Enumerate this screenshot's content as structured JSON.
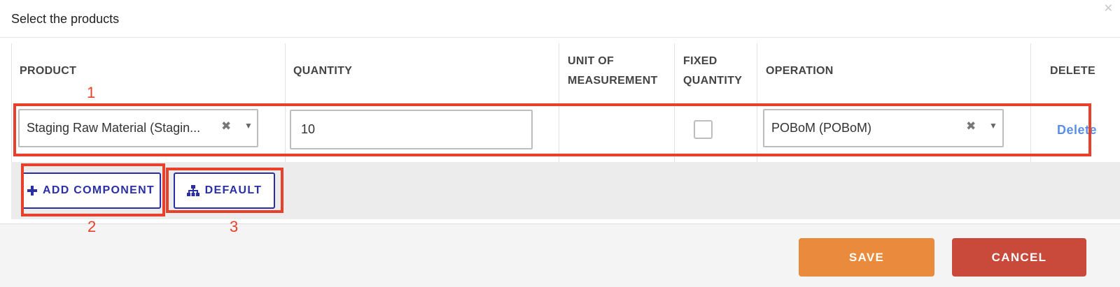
{
  "modal": {
    "title": "Select the products",
    "close_icon": "close-icon"
  },
  "table": {
    "headers": {
      "product": "PRODUCT",
      "quantity": "QUANTITY",
      "uom_line1": "UNIT OF",
      "uom_line2": "MEASUREMENT",
      "fixed_line1": "FIXED",
      "fixed_line2": "QUANTITY",
      "operation": "OPERATION",
      "delete": "DELETE"
    },
    "rows": [
      {
        "product": "Staging Raw Material (Stagin...",
        "quantity": "10",
        "unit_of_measurement": "",
        "fixed_quantity": false,
        "operation": "POBoM (POBoM)",
        "delete_label": "Delete"
      }
    ]
  },
  "actions": {
    "add_component": "ADD COMPONENT",
    "default": "DEFAULT"
  },
  "footer": {
    "save": "SAVE",
    "cancel": "CANCEL"
  },
  "annotations": [
    "1",
    "2",
    "3"
  ],
  "colors": {
    "accent_blue": "#2b2fa6",
    "link_blue": "#5a8fe6",
    "save_orange": "#e98a3c",
    "cancel_red": "#c9493b",
    "annotation_red": "#e8402a"
  }
}
